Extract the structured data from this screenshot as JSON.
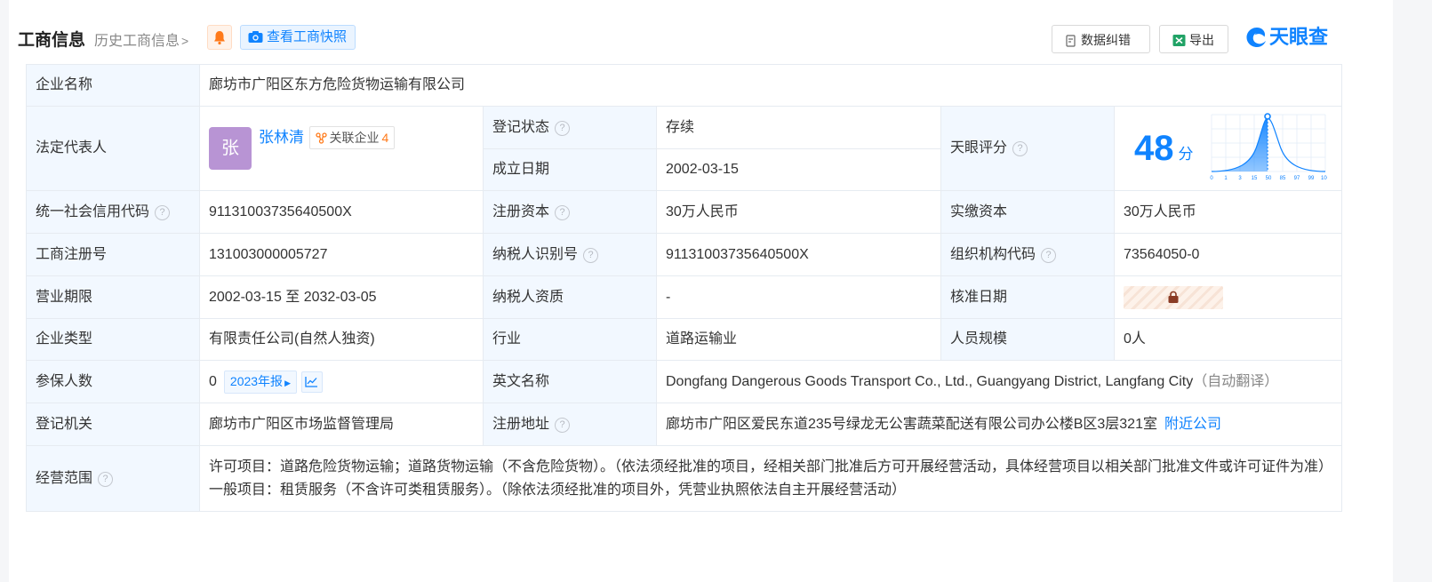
{
  "header": {
    "title": "工商信息",
    "history_label": "历史工商信息",
    "snapshot_label": "查看工商快照",
    "fix_label": "数据纠错",
    "export_label": "导出",
    "logo_text": "天眼查"
  },
  "rows": {
    "company_name_label": "企业名称",
    "company_name": "廊坊市广阳区东方危险货物运输有限公司",
    "legal_rep_label": "法定代表人",
    "avatar_char": "张",
    "legal_rep_name": "张林清",
    "related_label": "关联企业",
    "related_count": "4",
    "reg_status_label": "登记状态",
    "reg_status": "存续",
    "est_date_label": "成立日期",
    "est_date": "2002-03-15",
    "score_label": "天眼评分",
    "score": "48",
    "score_unit": "分",
    "credit_code_label": "统一社会信用代码",
    "credit_code": "91131003735640500X",
    "reg_capital_label": "注册资本",
    "reg_capital": "30万人民币",
    "paid_capital_label": "实缴资本",
    "paid_capital": "30万人民币",
    "reg_no_label": "工商注册号",
    "reg_no": "131003000005727",
    "taxpayer_id_label": "纳税人识别号",
    "taxpayer_id": "91131003735640500X",
    "org_code_label": "组织机构代码",
    "org_code": "73564050-0",
    "term_label": "营业期限",
    "term": "2002-03-15 至 2032-03-05",
    "tax_qual_label": "纳税人资质",
    "tax_qual": "-",
    "approve_date_label": "核准日期",
    "type_label": "企业类型",
    "type": "有限责任公司(自然人独资)",
    "industry_label": "行业",
    "industry": "道路运输业",
    "staff_label": "人员规模",
    "staff": "0人",
    "insured_label": "参保人数",
    "insured": "0",
    "year_report": "2023年报",
    "en_name_label": "英文名称",
    "en_name": "Dongfang Dangerous Goods Transport Co., Ltd., Guangyang District, Langfang City",
    "auto_translate": "（自动翻译）",
    "authority_label": "登记机关",
    "authority": "廊坊市广阳区市场监督管理局",
    "address_label": "注册地址",
    "address": "廊坊市广阳区爱民东道235号绿龙无公害蔬菜配送有限公司办公楼B区3层321室",
    "nearby_label": "附近公司",
    "scope_label": "经营范围",
    "scope": "许可项目：道路危险货物运输；道路货物运输（不含危险货物）。（依法须经批准的项目，经相关部门批准后方可开展经营活动，具体经营项目以相关部门批准文件或许可证件为准）一般项目：租赁服务（不含许可类租赁服务）。（除依法须经批准的项目外，凭营业执照依法自主开展经营活动）"
  },
  "score_chart": {
    "ticks": [
      "0",
      "1",
      "3",
      "15",
      "50",
      "85",
      "97",
      "99",
      "100"
    ],
    "marker": "48"
  },
  "colors": {
    "accent": "#0f83ff",
    "label_bg": "#f2f8ff",
    "status_green": "#26a66b",
    "avatar_bg": "#b894d4"
  },
  "icons": {
    "bell": "bell-icon",
    "camera": "camera-icon",
    "fix": "document-edit-icon",
    "export": "excel-icon",
    "related": "network-icon",
    "lock": "lock-icon",
    "trend": "trend-chart-icon",
    "help": "question-circle-icon"
  }
}
